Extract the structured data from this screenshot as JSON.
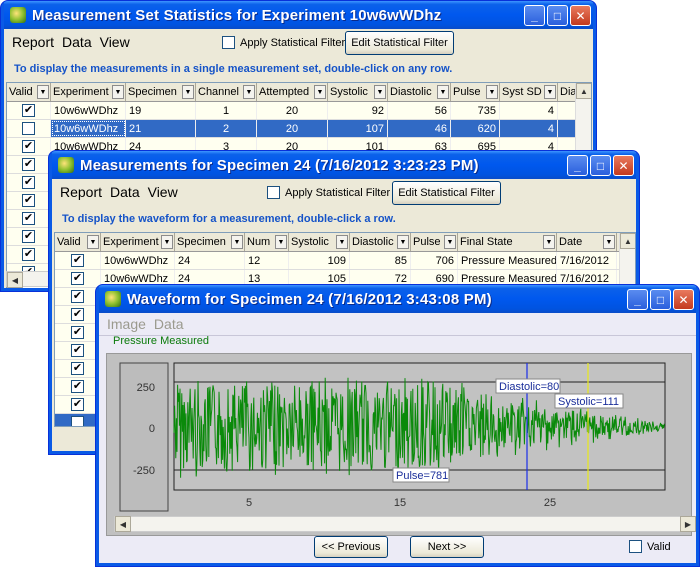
{
  "win1": {
    "title": "Measurement Set Statistics for Experiment 10w6wWDhz",
    "menu": [
      "Report",
      "Data",
      "View"
    ],
    "filter_label": "Apply Statistical Filter",
    "edit_filter": "Edit Statistical Filter",
    "hint": "To display the measurements in a single measurement set, double-click on any row.",
    "columns": [
      "Valid",
      "Experiment",
      "Specimen",
      "Channel",
      "Attempted",
      "Systolic",
      "Diastolic",
      "Pulse",
      "Syst SD",
      "Dia"
    ],
    "rows": [
      {
        "valid": "✔",
        "experiment": "10w6wWDhz",
        "specimen": "19",
        "channel": "1",
        "attempted": "20",
        "systolic": "92",
        "diastolic": "56",
        "pulse": "735",
        "syst_sd": "4"
      },
      {
        "valid": "✔",
        "experiment": "10w6wWDhz",
        "specimen": "21",
        "channel": "2",
        "attempted": "20",
        "systolic": "107",
        "diastolic": "46",
        "pulse": "620",
        "syst_sd": "4"
      },
      {
        "valid": "✔",
        "experiment": "10w6wWDhz",
        "specimen": "24",
        "channel": "3",
        "attempted": "20",
        "systolic": "101",
        "diastolic": "63",
        "pulse": "695",
        "syst_sd": "4"
      }
    ],
    "extra_checks": [
      "✔",
      "✔",
      "✔",
      "✔",
      "✔",
      "✔",
      "✔"
    ]
  },
  "win2": {
    "title": "Measurements for Specimen 24 (7/16/2012 3:23:23 PM)",
    "menu": [
      "Report",
      "Data",
      "View"
    ],
    "filter_label": "Apply Statistical Filter",
    "edit_filter": "Edit Statistical Filter",
    "hint": "To display the waveform for a measurement, double-click a row.",
    "columns": [
      "Valid",
      "Experiment",
      "Specimen",
      "Num",
      "Systolic",
      "Diastolic",
      "Pulse",
      "Final State",
      "Date"
    ],
    "rows": [
      {
        "valid": "✔",
        "experiment": "10w6wWDhz",
        "specimen": "24",
        "num": "12",
        "systolic": "109",
        "diastolic": "85",
        "pulse": "706",
        "state": "Pressure Measured",
        "date": "7/16/2012"
      },
      {
        "valid": "✔",
        "experiment": "10w6wWDhz",
        "specimen": "24",
        "num": "13",
        "systolic": "105",
        "diastolic": "72",
        "pulse": "690",
        "state": "Pressure Measured",
        "date": "7/16/2012"
      }
    ],
    "extra_checks": [
      "✔",
      "✔",
      "✔",
      "✔",
      "✔",
      "✔",
      "✔"
    ]
  },
  "win3": {
    "title": "Waveform for Specimen 24 (7/16/2012 3:43:08 PM)",
    "menu": [
      "Image",
      "Data"
    ],
    "status": "Pressure Measured",
    "y_ticks": [
      "250",
      "0",
      "-250"
    ],
    "x_ticks": [
      "5",
      "15",
      "25"
    ],
    "diastolic_label": "Diastolic=80",
    "systolic_label": "Systolic=111",
    "pulse_label": "Pulse=781",
    "prev": "<< Previous",
    "next": "Next >>",
    "valid_label": "Valid"
  }
}
